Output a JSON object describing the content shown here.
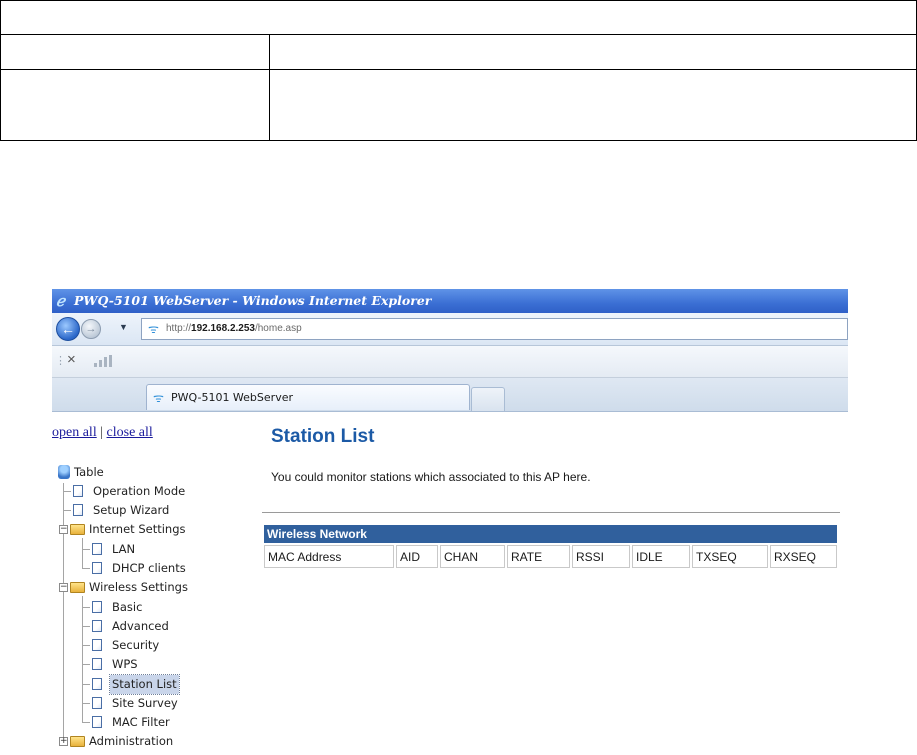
{
  "browser": {
    "window_title": "PWQ-5101 WebServer - Windows Internet Explorer",
    "url_prefix": "http://",
    "url_host": "192.168.2.253",
    "url_path": "/home.asp",
    "tab_title": "PWQ-5101 WebServer"
  },
  "tree": {
    "open_all": "open all",
    "separator": "|",
    "close_all": "close all",
    "root": "Table",
    "items": {
      "operation_mode": "Operation Mode",
      "setup_wizard": "Setup Wizard",
      "internet_settings": "Internet Settings",
      "lan": "LAN",
      "dhcp_clients": "DHCP clients",
      "wireless_settings": "Wireless Settings",
      "basic": "Basic",
      "advanced": "Advanced",
      "security": "Security",
      "wps": "WPS",
      "station_list": "Station List",
      "site_survey": "Site Survey",
      "mac_filter": "MAC Filter",
      "administration": "Administration"
    },
    "selected_item": "Station List"
  },
  "main": {
    "title": "Station List",
    "description": "You could monitor stations which associated to this AP here.",
    "table": {
      "section_header": "Wireless Network",
      "columns": [
        "MAC Address",
        "AID",
        "CHAN",
        "RATE",
        "RSSI",
        "IDLE",
        "TXSEQ",
        "RXSEQ"
      ]
    }
  },
  "colors": {
    "title_blue": "#1c5aa6",
    "table_header_bg": "#30609d",
    "titlebar_blue": "#3b6fd4"
  }
}
